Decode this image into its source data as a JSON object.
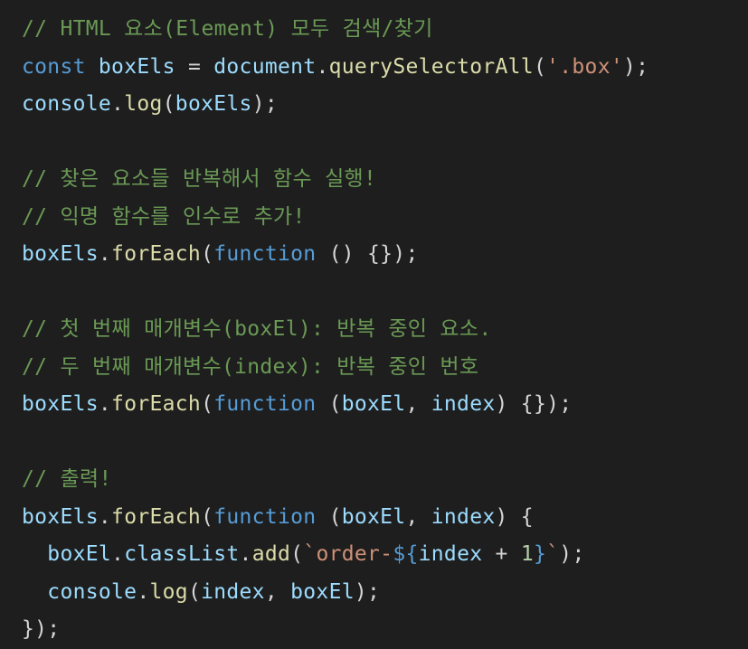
{
  "colors": {
    "background": "#1e1e1e",
    "comment": "#6a9955",
    "keyword": "#569cd6",
    "variable": "#9cdcfe",
    "function": "#dcdcaa",
    "punctuation": "#d4d4d4",
    "string": "#ce9178",
    "number": "#b5cea8"
  },
  "lines": [
    [
      {
        "t": "comment",
        "v": "// HTML 요소(Element) 모두 검색/찾기"
      }
    ],
    [
      {
        "t": "keyword",
        "v": "const"
      },
      {
        "t": "default",
        "v": " "
      },
      {
        "t": "variable",
        "v": "boxEls"
      },
      {
        "t": "default",
        "v": " = "
      },
      {
        "t": "variable",
        "v": "document"
      },
      {
        "t": "punct",
        "v": "."
      },
      {
        "t": "function",
        "v": "querySelectorAll"
      },
      {
        "t": "punct",
        "v": "("
      },
      {
        "t": "string",
        "v": "'.box'"
      },
      {
        "t": "punct",
        "v": ");"
      }
    ],
    [
      {
        "t": "variable",
        "v": "console"
      },
      {
        "t": "punct",
        "v": "."
      },
      {
        "t": "function",
        "v": "log"
      },
      {
        "t": "punct",
        "v": "("
      },
      {
        "t": "variable",
        "v": "boxEls"
      },
      {
        "t": "punct",
        "v": ");"
      }
    ],
    [],
    [
      {
        "t": "comment",
        "v": "// 찾은 요소들 반복해서 함수 실행!"
      }
    ],
    [
      {
        "t": "comment",
        "v": "// 익명 함수를 인수로 추가!"
      }
    ],
    [
      {
        "t": "variable",
        "v": "boxEls"
      },
      {
        "t": "punct",
        "v": "."
      },
      {
        "t": "function",
        "v": "forEach"
      },
      {
        "t": "punct",
        "v": "("
      },
      {
        "t": "keyword",
        "v": "function"
      },
      {
        "t": "default",
        "v": " () {});"
      }
    ],
    [],
    [
      {
        "t": "comment",
        "v": "// 첫 번째 매개변수(boxEl): 반복 중인 요소."
      }
    ],
    [
      {
        "t": "comment",
        "v": "// 두 번째 매개변수(index): 반복 중인 번호"
      }
    ],
    [
      {
        "t": "variable",
        "v": "boxEls"
      },
      {
        "t": "punct",
        "v": "."
      },
      {
        "t": "function",
        "v": "forEach"
      },
      {
        "t": "punct",
        "v": "("
      },
      {
        "t": "keyword",
        "v": "function"
      },
      {
        "t": "default",
        "v": " ("
      },
      {
        "t": "variable",
        "v": "boxEl"
      },
      {
        "t": "default",
        "v": ", "
      },
      {
        "t": "variable",
        "v": "index"
      },
      {
        "t": "default",
        "v": ") {});"
      }
    ],
    [],
    [
      {
        "t": "comment",
        "v": "// 출력!"
      }
    ],
    [
      {
        "t": "variable",
        "v": "boxEls"
      },
      {
        "t": "punct",
        "v": "."
      },
      {
        "t": "function",
        "v": "forEach"
      },
      {
        "t": "punct",
        "v": "("
      },
      {
        "t": "keyword",
        "v": "function"
      },
      {
        "t": "default",
        "v": " ("
      },
      {
        "t": "variable",
        "v": "boxEl"
      },
      {
        "t": "default",
        "v": ", "
      },
      {
        "t": "variable",
        "v": "index"
      },
      {
        "t": "default",
        "v": ") {"
      }
    ],
    [
      {
        "t": "default",
        "v": "  "
      },
      {
        "t": "variable",
        "v": "boxEl"
      },
      {
        "t": "punct",
        "v": "."
      },
      {
        "t": "variable",
        "v": "classList"
      },
      {
        "t": "punct",
        "v": "."
      },
      {
        "t": "function",
        "v": "add"
      },
      {
        "t": "punct",
        "v": "("
      },
      {
        "t": "string",
        "v": "`order-"
      },
      {
        "t": "keyword",
        "v": "${"
      },
      {
        "t": "variable",
        "v": "index"
      },
      {
        "t": "default",
        "v": " + "
      },
      {
        "t": "number",
        "v": "1"
      },
      {
        "t": "keyword",
        "v": "}"
      },
      {
        "t": "string",
        "v": "`"
      },
      {
        "t": "punct",
        "v": ");"
      }
    ],
    [
      {
        "t": "default",
        "v": "  "
      },
      {
        "t": "variable",
        "v": "console"
      },
      {
        "t": "punct",
        "v": "."
      },
      {
        "t": "function",
        "v": "log"
      },
      {
        "t": "punct",
        "v": "("
      },
      {
        "t": "variable",
        "v": "index"
      },
      {
        "t": "default",
        "v": ", "
      },
      {
        "t": "variable",
        "v": "boxEl"
      },
      {
        "t": "punct",
        "v": ");"
      }
    ],
    [
      {
        "t": "punct",
        "v": "});"
      }
    ]
  ]
}
